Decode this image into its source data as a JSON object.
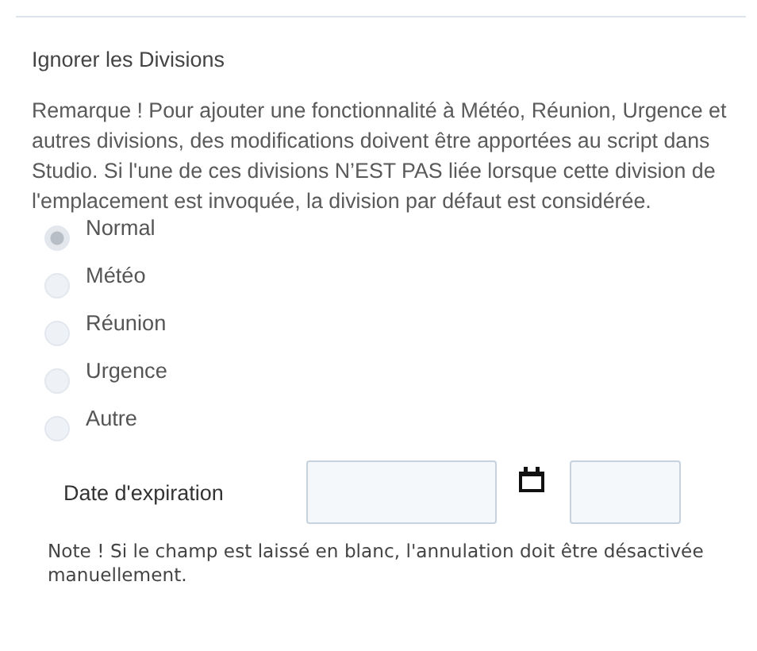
{
  "section": {
    "title": "Ignorer les Divisions",
    "remark": "Remarque ! Pour ajouter une fonctionnalité à Météo, Réunion, Urgence et autres divisions, des modifications doivent être apportées au script dans Studio. Si l'une de ces divisions N’EST PAS liée lorsque cette division de l'emplacement est invoquée, la division par défaut est considérée.",
    "options": [
      {
        "label": "Normal",
        "selected": true,
        "disabled": true
      },
      {
        "label": "Météo",
        "selected": false,
        "disabled": true
      },
      {
        "label": "Réunion",
        "selected": false,
        "disabled": true
      },
      {
        "label": "Urgence",
        "selected": false,
        "disabled": true
      },
      {
        "label": "Autre",
        "selected": false,
        "disabled": true
      }
    ],
    "expiration": {
      "label": "Date d'expiration"
    },
    "note": "Note ! Si le champ est laissé en blanc, l'annulation doit être désactivée manuellement."
  }
}
